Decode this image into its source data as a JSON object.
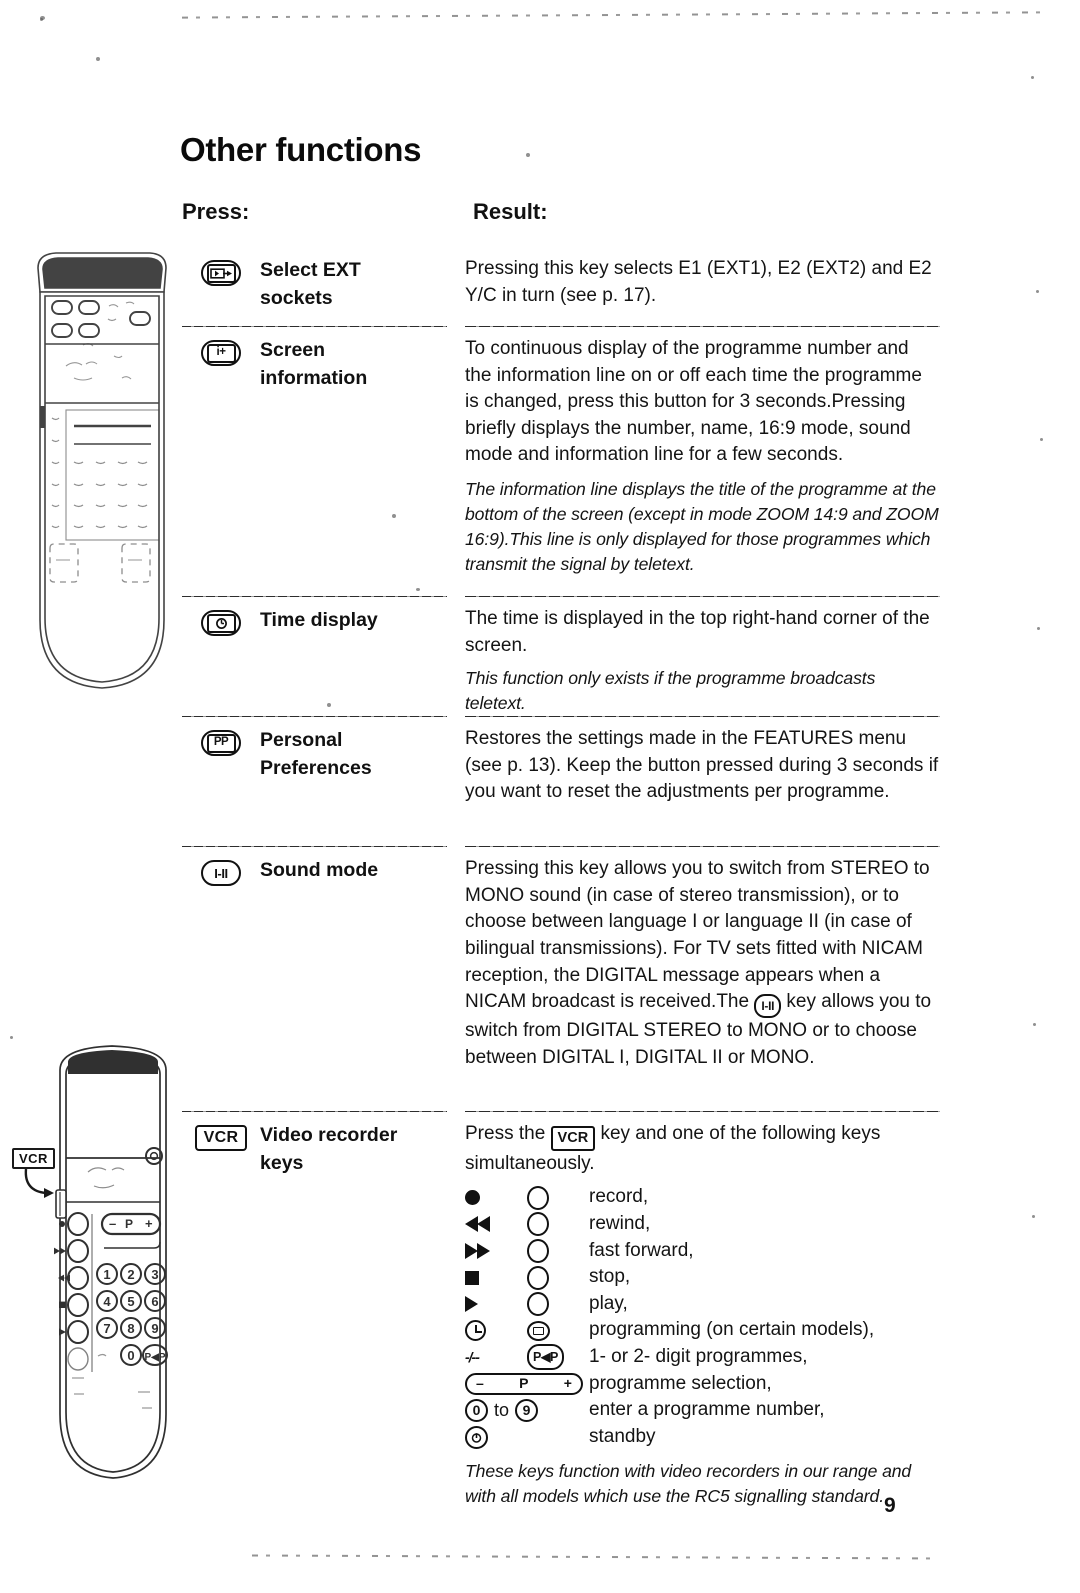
{
  "document": {
    "title": "Other functions",
    "page_number": "9",
    "columns": {
      "press": "Press:",
      "result": "Result:"
    }
  },
  "rows": [
    {
      "key_icon": "select-ext-sockets-key-icon",
      "key_glyph": "◀▶",
      "label": "Select EXT\nsockets",
      "label_line1": "Select EXT",
      "label_line2": "sockets",
      "result": "Pressing this key selects E1 (EXT1), E2 (EXT2) and E2 Y/C in turn (see p. 17).",
      "note": ""
    },
    {
      "key_icon": "screen-information-key-icon",
      "key_glyph": "i+",
      "label_line1": "Screen",
      "label_line2": "information",
      "result": "To continuous display of the programme number and the information line on or off each time the programme is changed, press this button for 3 seconds.Pressing briefly displays the number, name, 16:9 mode, sound mode and information line for a few seconds.",
      "note": "The information line displays the title of the programme at the bottom of the screen (except in mode ZOOM 14:9 and ZOOM 16:9).This line is only displayed for those programmes which transmit the signal by teletext."
    },
    {
      "key_icon": "time-display-key-icon",
      "key_glyph": "⏱",
      "label_line1": "Time display",
      "label_line2": "",
      "result": "The time is displayed in the top right-hand corner of the screen.",
      "note": "This function only exists if the programme broadcasts teletext."
    },
    {
      "key_icon": "personal-preferences-key-icon",
      "key_glyph": "PP",
      "label_line1": "Personal",
      "label_line2": "Preferences",
      "result": "Restores the settings made in the FEATURES menu (see p. 13). Keep the button pressed during 3 seconds if you want to reset the adjustments per programme.",
      "note": ""
    },
    {
      "key_icon": "sound-mode-key-icon",
      "key_glyph": "I-II",
      "label_line1": "Sound mode",
      "label_line2": "",
      "result_part1": "Pressing this key allows you to switch from STEREO to MONO sound (in case of stereo transmission), or to choose between language I or language II (in case of bilingual transmissions). For TV sets fitted with NICAM reception, the DIGITAL message appears when a NICAM broadcast is received.The ",
      "inline_key": "I-II",
      "result_part2": " key allows you to switch from DIGITAL STEREO to MONO or to choose between DIGITAL I, DIGITAL II or MONO.",
      "note": ""
    },
    {
      "key_icon": "vcr-key-icon",
      "key_glyph": "VCR",
      "label_line1": "Video recorder",
      "label_line2": "keys",
      "intro_part1": "Press the ",
      "inline_key": "VCR",
      "intro_part2": " key and one of the following keys simultaneously.",
      "note": "These keys function with video recorders in our range and with all models which use the RC5 signalling standard."
    }
  ],
  "vcr_keys": [
    {
      "glyph1": "record-dot-icon",
      "glyph2": "circle-outline-icon",
      "label": "record,"
    },
    {
      "glyph1": "rewind-icon",
      "glyph2": "circle-outline-icon",
      "label": "rewind,"
    },
    {
      "glyph1": "fast-forward-icon",
      "glyph2": "circle-outline-icon",
      "label": "fast forward,"
    },
    {
      "glyph1": "stop-square-icon",
      "glyph2": "circle-outline-icon",
      "label": "stop,"
    },
    {
      "glyph1": "play-triangle-icon",
      "glyph2": "circle-outline-icon",
      "label": "play,"
    },
    {
      "glyph1": "clock-icon",
      "glyph2": "menu-oval-icon",
      "label": "programming (on certain models),"
    },
    {
      "glyph1": "one-two-digit-icon",
      "glyph2": "p-swap-icon",
      "label": "1- or 2- digit programmes,",
      "glyph1_text": "-/--",
      "glyph2_text": "P◀P"
    },
    {
      "glyph1": "programme-bar-icon",
      "glyph2": "",
      "label": "programme selection,",
      "bar_minus": "–",
      "bar_p": "P",
      "bar_plus": "+"
    },
    {
      "glyph1": "digit-zero-icon",
      "glyph2": "digit-nine-icon",
      "label": "enter a programme number,",
      "glyph1_text": "0",
      "to_text": "to",
      "glyph2_text": "9"
    },
    {
      "glyph1": "standby-icon",
      "glyph2": "",
      "label": "standby"
    }
  ],
  "illustrations": {
    "top_remote": {
      "name": "tv-remote-control-illustration-top"
    },
    "bottom_remote": {
      "name": "tv-remote-control-illustration-bottom",
      "vcr_callout_label": "VCR",
      "programme_bar": {
        "minus": "–",
        "p": "P",
        "plus": "+"
      },
      "keypad": [
        "1",
        "2",
        "3",
        "4",
        "5",
        "6",
        "7",
        "8",
        "9",
        "0"
      ],
      "keypad_extra": "P◀P"
    }
  },
  "colors": {
    "ink": "#111111",
    "paper": "#ffffff",
    "rule": "#2d2d2d"
  }
}
